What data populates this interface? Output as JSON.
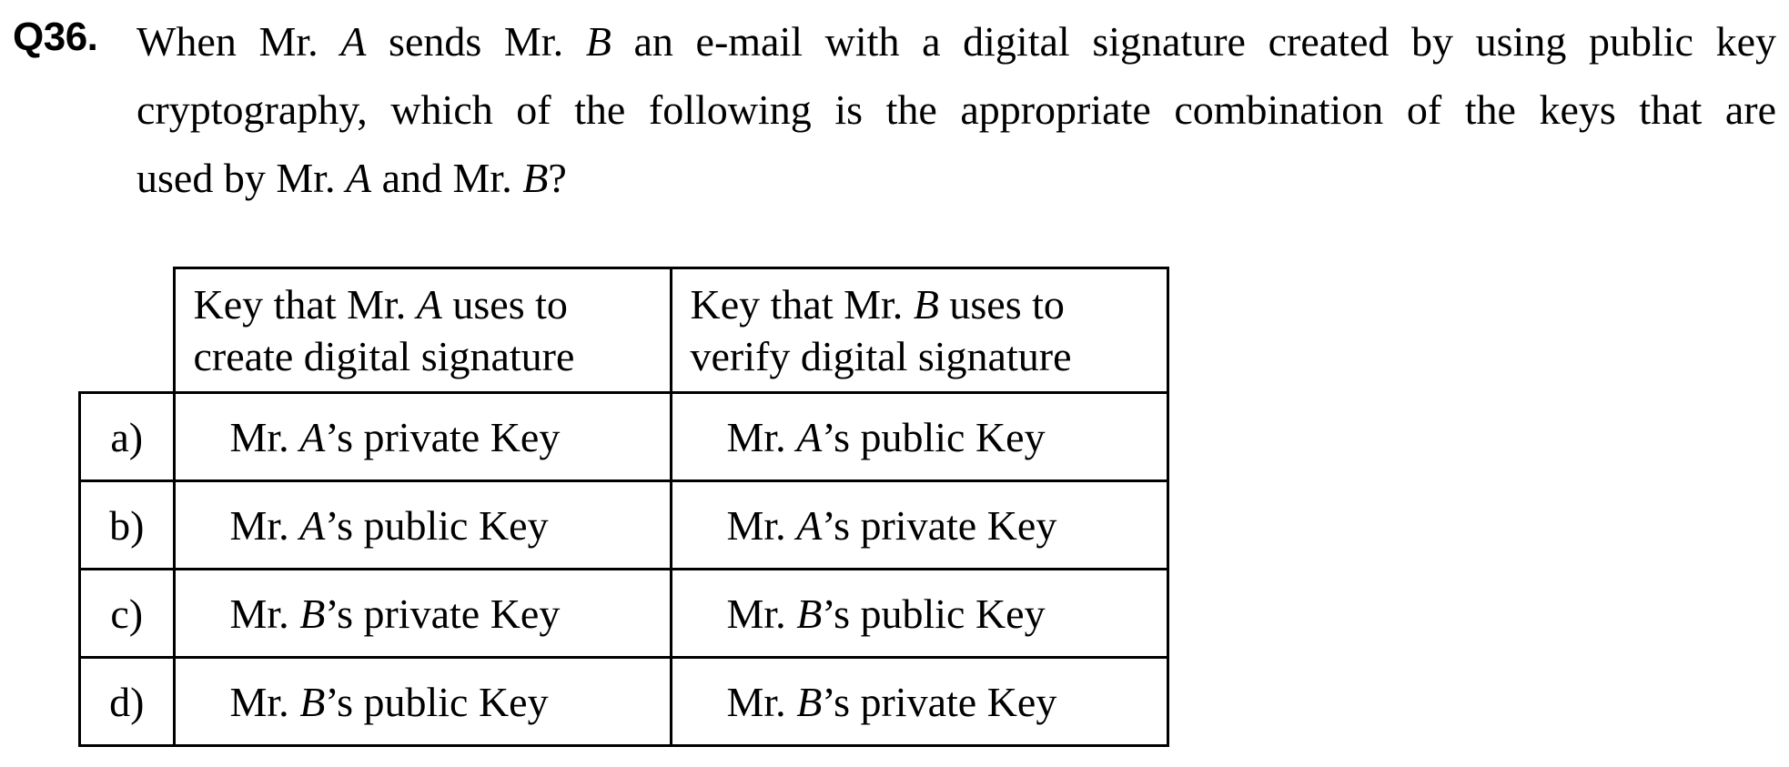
{
  "question": {
    "number": "Q36.",
    "line1_a": "When Mr. ",
    "line1_A": "A",
    "line1_b": " sends Mr. ",
    "line1_B": "B",
    "line1_c": " an e-mail with a digital signature created by using public key",
    "line2": "cryptography, which of the following is the appropriate combination of the keys that are",
    "line3_a": "used by Mr. ",
    "line3_A": "A",
    "line3_b": " and Mr. ",
    "line3_B": "B",
    "line3_c": "?"
  },
  "table": {
    "header_col1_a": "Key that Mr. ",
    "header_col1_A": "A",
    "header_col1_b": " uses to",
    "header_col1_c": "create digital signature",
    "header_col2_a": "Key that Mr. ",
    "header_col2_B": "B",
    "header_col2_b": " uses to",
    "header_col2_c": "verify digital signature",
    "rows": [
      {
        "label": "a)",
        "col1": {
          "prefix": "Mr. ",
          "who": "A",
          "suffix": "’s private Key"
        },
        "col2": {
          "prefix": "Mr. ",
          "who": "A",
          "suffix": "’s public Key"
        }
      },
      {
        "label": "b)",
        "col1": {
          "prefix": "Mr. ",
          "who": "A",
          "suffix": "’s public Key"
        },
        "col2": {
          "prefix": "Mr. ",
          "who": "A",
          "suffix": "’s private Key"
        }
      },
      {
        "label": "c)",
        "col1": {
          "prefix": "Mr. ",
          "who": "B",
          "suffix": "’s private Key"
        },
        "col2": {
          "prefix": "Mr. ",
          "who": "B",
          "suffix": "’s public Key"
        }
      },
      {
        "label": "d)",
        "col1": {
          "prefix": "Mr. ",
          "who": "B",
          "suffix": "’s public Key"
        },
        "col2": {
          "prefix": "Mr. ",
          "who": "B",
          "suffix": "’s private Key"
        }
      }
    ]
  }
}
